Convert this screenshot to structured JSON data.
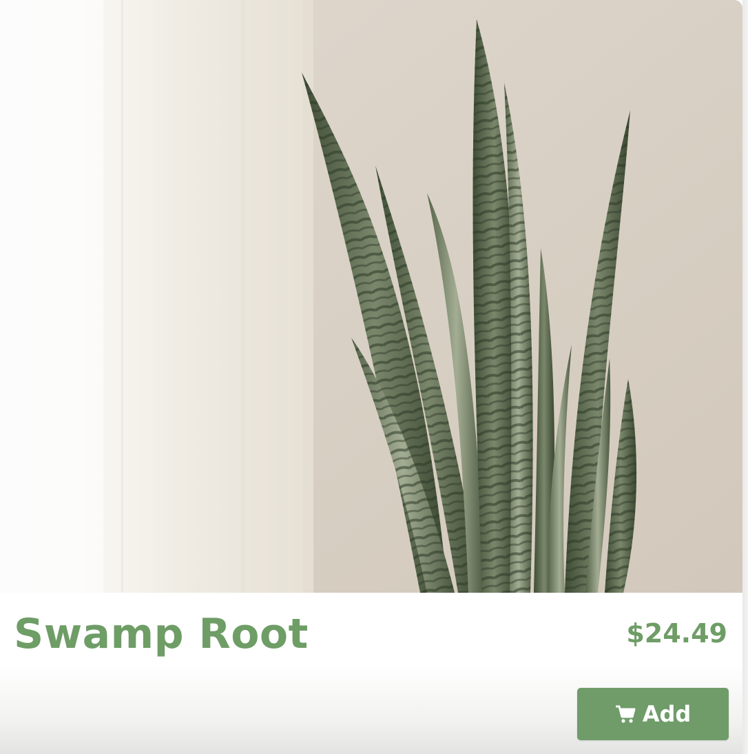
{
  "product": {
    "name": "Swamp Root",
    "price": "$24.49",
    "image_subject": "snake plant in front of a sheer curtain"
  },
  "actions": {
    "add_label": "Add",
    "add_icon": "shopping-cart-icon"
  },
  "colors": {
    "accent": "#6e9d66",
    "button": "#6f9c69",
    "button_text": "#ffffff"
  }
}
